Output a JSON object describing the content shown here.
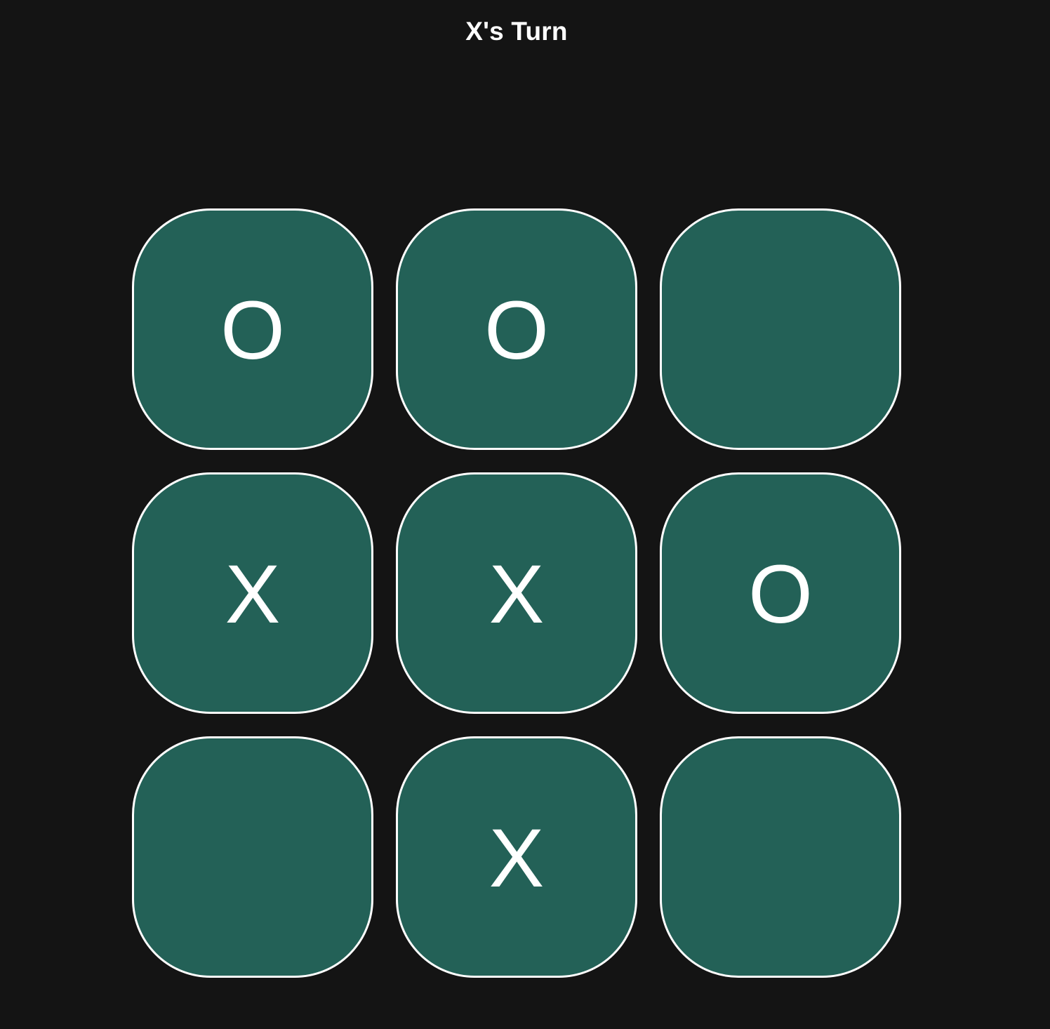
{
  "status": {
    "text": "X's Turn"
  },
  "board": {
    "cells": [
      {
        "mark": "O"
      },
      {
        "mark": "O"
      },
      {
        "mark": ""
      },
      {
        "mark": "X"
      },
      {
        "mark": "X"
      },
      {
        "mark": "O"
      },
      {
        "mark": ""
      },
      {
        "mark": "X"
      },
      {
        "mark": ""
      }
    ]
  },
  "colors": {
    "background": "#141414",
    "cell_fill": "#236157",
    "cell_border": "#ffffff",
    "text": "#ffffff"
  }
}
